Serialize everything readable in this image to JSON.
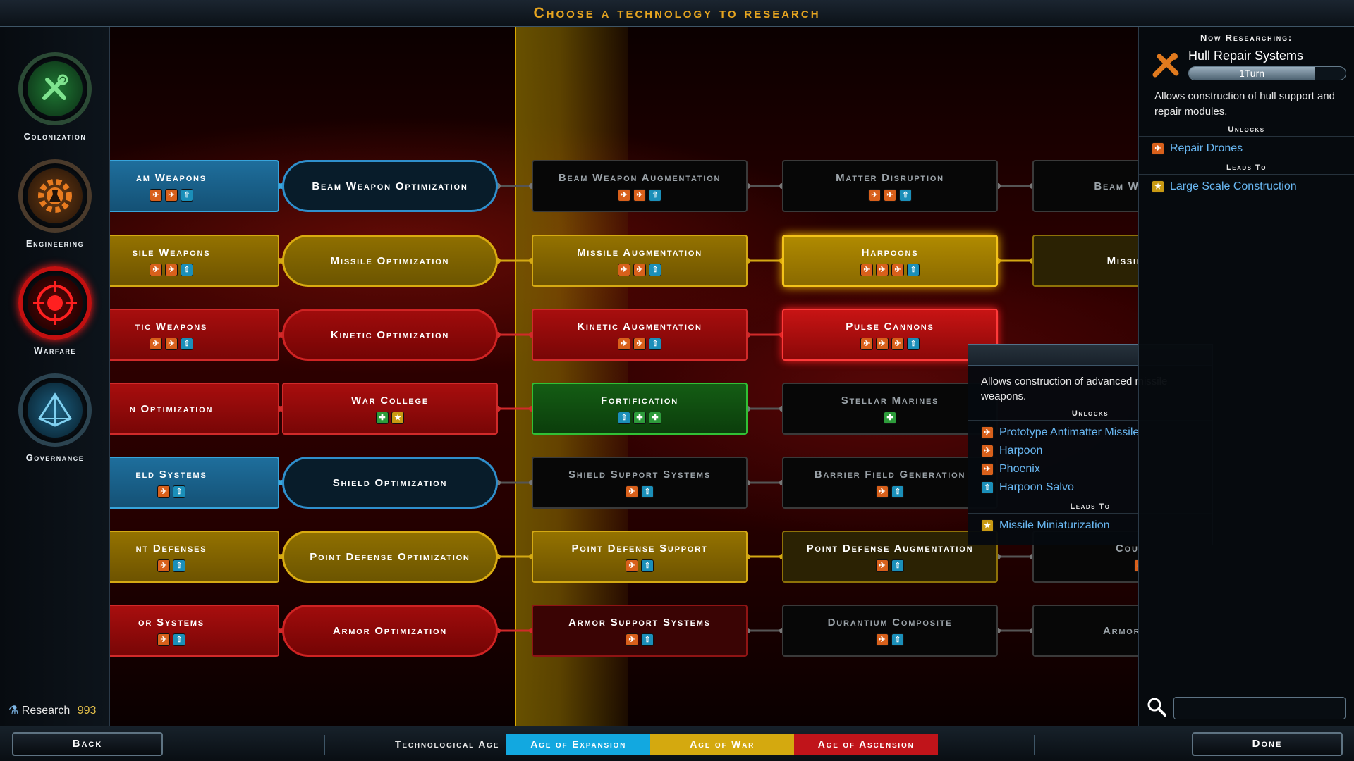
{
  "screen_title": "Choose a technology to research",
  "sidebar": {
    "categories": [
      {
        "label": "Colonization",
        "icon": "colonization-icon",
        "color": "#2fa84a"
      },
      {
        "label": "Engineering",
        "icon": "engineering-icon",
        "color": "#e07a1e"
      },
      {
        "label": "Warfare",
        "icon": "warfare-icon",
        "color": "#e01818"
      },
      {
        "label": "Governance",
        "icon": "governance-icon",
        "color": "#3aa7d8"
      }
    ],
    "research_label": "Research",
    "research_value": "993"
  },
  "ages": {
    "label": "Technological Age",
    "items": [
      {
        "label": "Age of Expansion",
        "color": "#12a8e0"
      },
      {
        "label": "Age of War",
        "color": "#d4a90f"
      },
      {
        "label": "Age of Ascension",
        "color": "#c0141a"
      }
    ]
  },
  "tree": {
    "rows": [
      {
        "color": "#3aa7dd",
        "nodes": [
          {
            "name": "am Weapons",
            "icons": [
              "o",
              "o",
              "c"
            ]
          },
          {
            "name": "Beam Weapon Optimization",
            "icons": []
          },
          {
            "name": "Beam Weapon Augmentation",
            "icons": [
              "o",
              "o",
              "c"
            ]
          },
          {
            "name": "Matter Disruption",
            "icons": [
              "o",
              "o",
              "c"
            ]
          },
          {
            "name": "Beam W Miniatu",
            "icons": []
          }
        ]
      },
      {
        "color": "#d4a913",
        "nodes": [
          {
            "name": "sile Weapons",
            "icons": [
              "o",
              "o",
              "c"
            ]
          },
          {
            "name": "Missile Optimization",
            "icons": []
          },
          {
            "name": "Missile Augmentation",
            "icons": [
              "o",
              "o",
              "c"
            ]
          },
          {
            "name": "Harpoons",
            "icons": [
              "o",
              "o",
              "o",
              "c"
            ]
          },
          {
            "name": "Missile Min",
            "icons": []
          }
        ]
      },
      {
        "color": "#d12a2a",
        "nodes": [
          {
            "name": "tic Weapons",
            "icons": [
              "o",
              "o",
              "c"
            ]
          },
          {
            "name": "Kinetic Optimization",
            "icons": []
          },
          {
            "name": "Kinetic Augmentation",
            "icons": [
              "o",
              "o",
              "c"
            ]
          },
          {
            "name": "Pulse Cannons",
            "icons": [
              "o",
              "o",
              "o",
              "c"
            ]
          }
        ]
      },
      {
        "color": "#d12a2a",
        "nodes": [
          {
            "name": "n Optimization",
            "icons": []
          },
          {
            "name": "War College",
            "icons": [
              "g",
              "y"
            ]
          },
          {
            "name": "Fortification",
            "icons": [
              "c",
              "g",
              "g"
            ]
          },
          {
            "name": "Stellar Marines",
            "icons": [
              "g"
            ]
          }
        ]
      },
      {
        "color": "#3aa7dd",
        "nodes": [
          {
            "name": "eld Systems",
            "icons": [
              "o",
              "c"
            ]
          },
          {
            "name": "Shield Optimization",
            "icons": []
          },
          {
            "name": "Shield Support Systems",
            "icons": [
              "o",
              "c"
            ]
          },
          {
            "name": "Barrier Field Generation",
            "icons": [
              "o",
              "c"
            ]
          }
        ]
      },
      {
        "color": "#d4a913",
        "nodes": [
          {
            "name": "nt Defenses",
            "icons": [
              "o",
              "c"
            ]
          },
          {
            "name": "Point Defense Optimization",
            "icons": []
          },
          {
            "name": "Point Defense Support",
            "icons": [
              "o",
              "c"
            ]
          },
          {
            "name": "Point Defense Augmentation",
            "icons": [
              "o",
              "c"
            ]
          },
          {
            "name": "Counter",
            "icons": [
              "o"
            ]
          }
        ]
      },
      {
        "color": "#d12a2a",
        "nodes": [
          {
            "name": "or Systems",
            "icons": [
              "o",
              "c"
            ]
          },
          {
            "name": "Armor Optimization",
            "icons": []
          },
          {
            "name": "Armor Support Systems",
            "icons": [
              "o",
              "c"
            ]
          },
          {
            "name": "Durantium Composite",
            "icons": [
              "o",
              "c"
            ]
          },
          {
            "name": "Armor M Sci",
            "icons": []
          }
        ]
      }
    ]
  },
  "tooltip": {
    "description": "Allows construction of advanced missile weapons.",
    "unlocks_label": "Unlocks",
    "unlocks": [
      {
        "label": "Prototype Antimatter Missile",
        "icon": "o"
      },
      {
        "label": "Harpoon",
        "icon": "o"
      },
      {
        "label": "Phoenix",
        "icon": "o"
      },
      {
        "label": "Harpoon Salvo",
        "icon": "c"
      }
    ],
    "leads_to_label": "Leads To",
    "leads_to": [
      {
        "label": "Missile Miniaturization",
        "icon": "y"
      }
    ]
  },
  "now_researching": {
    "heading": "Now Researching:",
    "name": "Hull Repair Systems",
    "turns": "1Turn",
    "progress": 0.8,
    "description": "Allows construction of hull support and repair modules.",
    "unlocks_label": "Unlocks",
    "unlocks": [
      {
        "label": "Repair Drones",
        "icon": "o"
      }
    ],
    "leads_to_label": "Leads To",
    "leads_to": [
      {
        "label": "Large Scale Construction",
        "icon": "y"
      }
    ]
  },
  "buttons": {
    "back": "Back",
    "done": "Done"
  }
}
